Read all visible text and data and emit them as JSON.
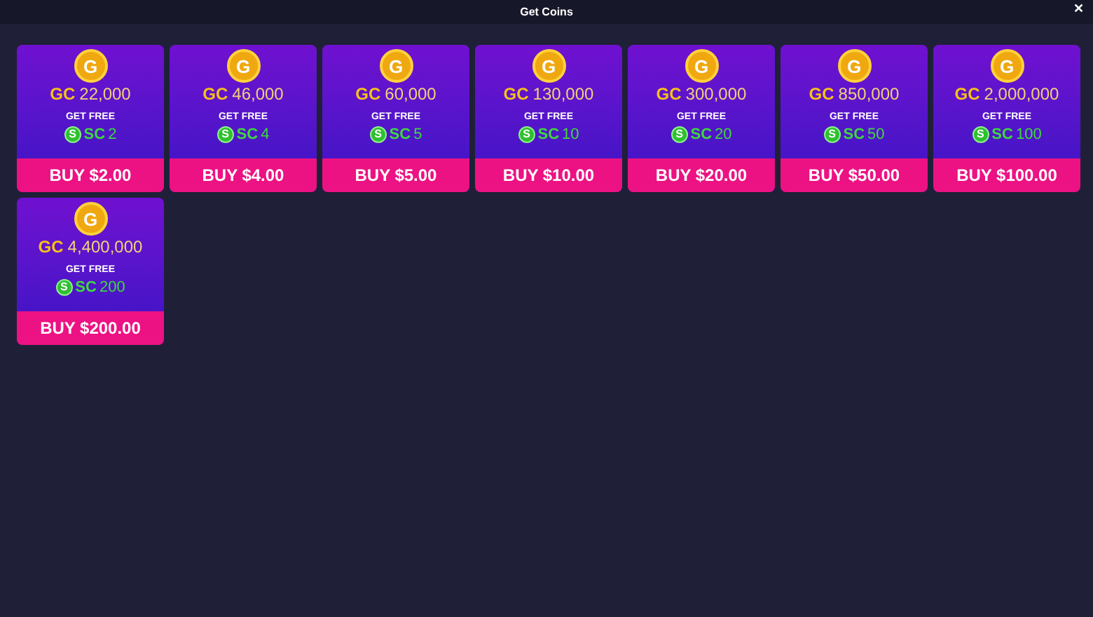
{
  "window": {
    "title": "Get Coins",
    "close": "✕"
  },
  "packages": [
    {
      "coin_glyph": "G",
      "gc_label": "GC",
      "gc_amount": "22,000",
      "bonus_label": "GET FREE",
      "sc_glyph": "S",
      "sc_label": "SC",
      "sc_amount": "2",
      "button": "BUY $2.00"
    },
    {
      "coin_glyph": "G",
      "gc_label": "GC",
      "gc_amount": "46,000",
      "bonus_label": "GET FREE",
      "sc_glyph": "S",
      "sc_label": "SC",
      "sc_amount": "4",
      "button": "BUY $4.00"
    },
    {
      "coin_glyph": "G",
      "gc_label": "GC",
      "gc_amount": "60,000",
      "bonus_label": "GET FREE",
      "sc_glyph": "S",
      "sc_label": "SC",
      "sc_amount": "5",
      "button": "BUY $5.00"
    },
    {
      "coin_glyph": "G",
      "gc_label": "GC",
      "gc_amount": "130,000",
      "bonus_label": "GET FREE",
      "sc_glyph": "S",
      "sc_label": "SC",
      "sc_amount": "10",
      "button": "BUY $10.00"
    },
    {
      "coin_glyph": "G",
      "gc_label": "GC",
      "gc_amount": "300,000",
      "bonus_label": "GET FREE",
      "sc_glyph": "S",
      "sc_label": "SC",
      "sc_amount": "20",
      "button": "BUY $20.00"
    },
    {
      "coin_glyph": "G",
      "gc_label": "GC",
      "gc_amount": "850,000",
      "bonus_label": "GET FREE",
      "sc_glyph": "S",
      "sc_label": "SC",
      "sc_amount": "50",
      "button": "BUY $50.00"
    },
    {
      "coin_glyph": "G",
      "gc_label": "GC",
      "gc_amount": "2,000,000",
      "bonus_label": "GET FREE",
      "sc_glyph": "S",
      "sc_label": "SC",
      "sc_amount": "100",
      "button": "BUY $100.00"
    },
    {
      "coin_glyph": "G",
      "gc_label": "GC",
      "gc_amount": "4,400,000",
      "bonus_label": "GET FREE",
      "sc_glyph": "S",
      "sc_label": "SC",
      "sc_amount": "200",
      "button": "BUY $200.00"
    }
  ]
}
